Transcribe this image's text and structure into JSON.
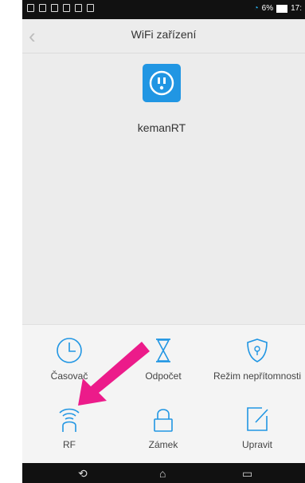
{
  "status": {
    "left_icons": [
      "menu",
      "mail",
      "alert",
      "gallery",
      "record",
      "record"
    ],
    "battery_text": "6%",
    "time": "17:"
  },
  "nav": {
    "title": "WiFi zařízení"
  },
  "device": {
    "name": "kemanRT"
  },
  "actions": [
    {
      "label": "Časovač",
      "icon": "clock-icon"
    },
    {
      "label": "Odpočet",
      "icon": "hourglass-icon"
    },
    {
      "label": "Režim nepřítomnosti",
      "icon": "shield-icon"
    },
    {
      "label": "RF",
      "icon": "rf-icon"
    },
    {
      "label": "Zámek",
      "icon": "lock-icon"
    },
    {
      "label": "Upravit",
      "icon": "edit-icon"
    }
  ],
  "colors": {
    "accent": "#2196e3",
    "arrow": "#ec1b8a"
  }
}
